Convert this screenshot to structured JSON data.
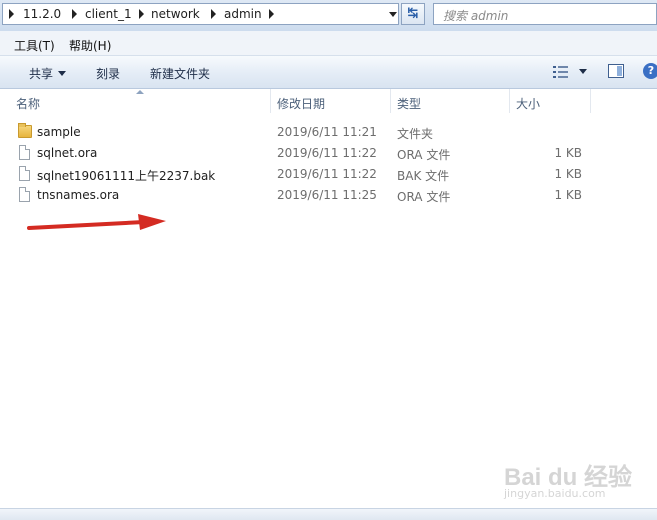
{
  "address": {
    "crumbs": [
      "11.2.0",
      "client_1",
      "network",
      "admin"
    ]
  },
  "search": {
    "placeholder": "搜索 admin"
  },
  "menu": {
    "tools": "工具(T)",
    "help": "帮助(H)"
  },
  "toolbar": {
    "share": "共享",
    "burn": "刻录",
    "new_folder": "新建文件夹"
  },
  "columns": {
    "name": "名称",
    "date": "修改日期",
    "type": "类型",
    "size": "大小"
  },
  "files": [
    {
      "name": "sample",
      "date": "2019/6/11 11:21",
      "type": "文件夹",
      "size": "",
      "icon": "folder-icon"
    },
    {
      "name": "sqlnet.ora",
      "date": "2019/6/11 11:22",
      "type": "ORA 文件",
      "size": "1 KB",
      "icon": "file-icon"
    },
    {
      "name": "sqlnet19061111上午2237.bak",
      "date": "2019/6/11 11:22",
      "type": "BAK 文件",
      "size": "1 KB",
      "icon": "file-icon"
    },
    {
      "name": "tnsnames.ora",
      "date": "2019/6/11 11:25",
      "type": "ORA 文件",
      "size": "1 KB",
      "icon": "file-icon"
    }
  ],
  "watermark": {
    "main": "Bai du 经验",
    "sub": "jingyan.baidu.com"
  },
  "colors": {
    "annotation_arrow": "#d42b22",
    "accent": "#3a6fc4"
  }
}
